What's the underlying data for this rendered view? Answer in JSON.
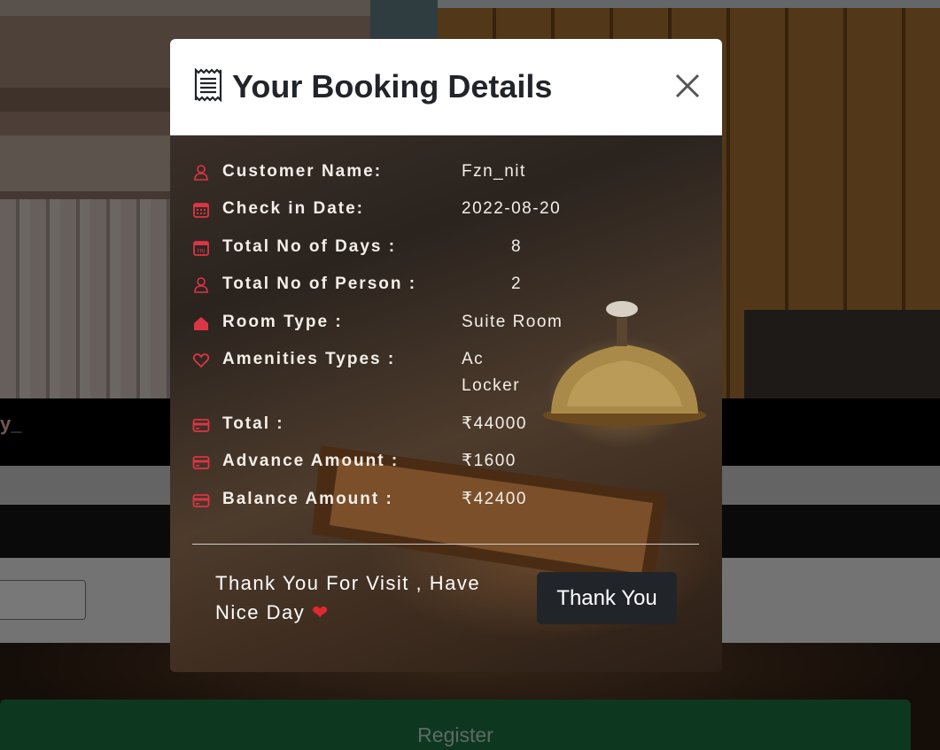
{
  "background": {
    "band_text": "y_",
    "register_label": "Register"
  },
  "modal": {
    "title": "Your Booking Details",
    "title_icon": "receipt-icon",
    "close_icon": "close-icon",
    "details": [
      {
        "icon": "person-icon",
        "label": "Customer Name:",
        "value": "Fzn_nit"
      },
      {
        "icon": "calendar-grid-icon",
        "label": "Check in Date:",
        "value": "2022-08-20"
      },
      {
        "icon": "calendar-day-icon",
        "label": "Total No of Days :",
        "value": "8"
      },
      {
        "icon": "person-icon",
        "label": "Total No of Person :",
        "value": "2"
      },
      {
        "icon": "house-icon",
        "label": "Room Type :",
        "value": "Suite Room"
      },
      {
        "icon": "heart-outline-icon",
        "label": "Amenities Types :",
        "value": "Ac",
        "value2": "Locker"
      },
      {
        "icon": "card-icon",
        "label": "Total :",
        "value": "₹44000"
      },
      {
        "icon": "card-icon",
        "label": "Advance Amount :",
        "value": "₹1600"
      },
      {
        "icon": "card-icon",
        "label": "Balance Amount :",
        "value": "₹42400"
      }
    ],
    "footer_text": "Thank You For Visit , Have Nice Day",
    "footer_emoji": "❤",
    "button_label": "Thank You"
  },
  "colors": {
    "accent_red": "#dc3545",
    "button_dark": "#212529",
    "register_green": "#1d6e3f"
  }
}
